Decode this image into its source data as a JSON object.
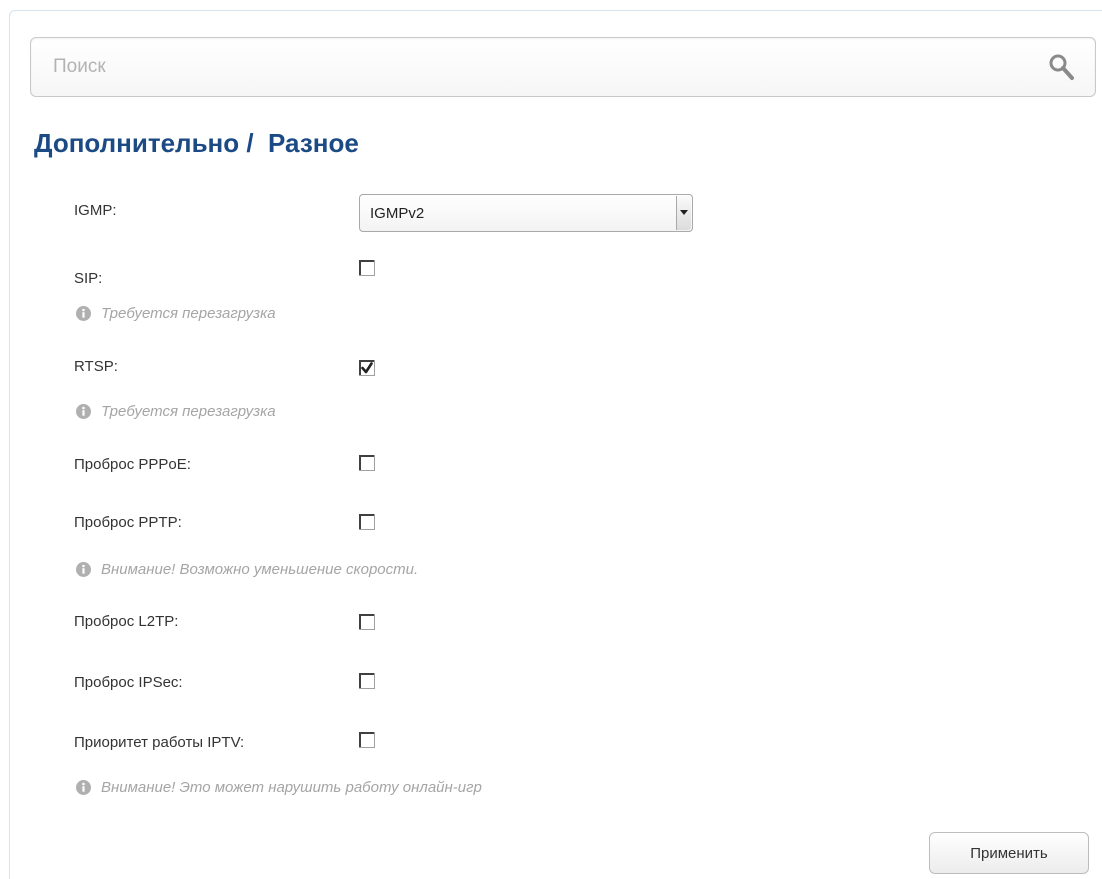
{
  "search": {
    "placeholder": "Поиск",
    "value": ""
  },
  "page": {
    "title": "Дополнительно /  Разное"
  },
  "form": {
    "igmp": {
      "label": "IGMP:",
      "selected": "IGMPv2"
    },
    "sip": {
      "label": "SIP:",
      "checked": false,
      "hint": "Требуется перезагрузка"
    },
    "rtsp": {
      "label": "RTSP:",
      "checked": true,
      "hint": "Требуется перезагрузка"
    },
    "pppoe": {
      "label": "Проброс PPPoE:",
      "checked": false
    },
    "pptp": {
      "label": "Проброс PPTP:",
      "checked": false,
      "hint": "Внимание! Возможно уменьшение скорости."
    },
    "l2tp": {
      "label": "Проброс L2TP:",
      "checked": false
    },
    "ipsec": {
      "label": "Проброс IPSec:",
      "checked": false
    },
    "iptv": {
      "label": "Приоритет работы IPTV:",
      "checked": false,
      "hint": "Внимание! Это может нарушить работу онлайн-игр"
    }
  },
  "actions": {
    "apply_label": "Применить"
  },
  "icons": {
    "search": "search-icon",
    "info": "info-icon",
    "dropdown": "chevron-down-icon"
  },
  "colors": {
    "title": "#1b4a84",
    "hint": "#a5a5a5",
    "label": "#333333"
  }
}
